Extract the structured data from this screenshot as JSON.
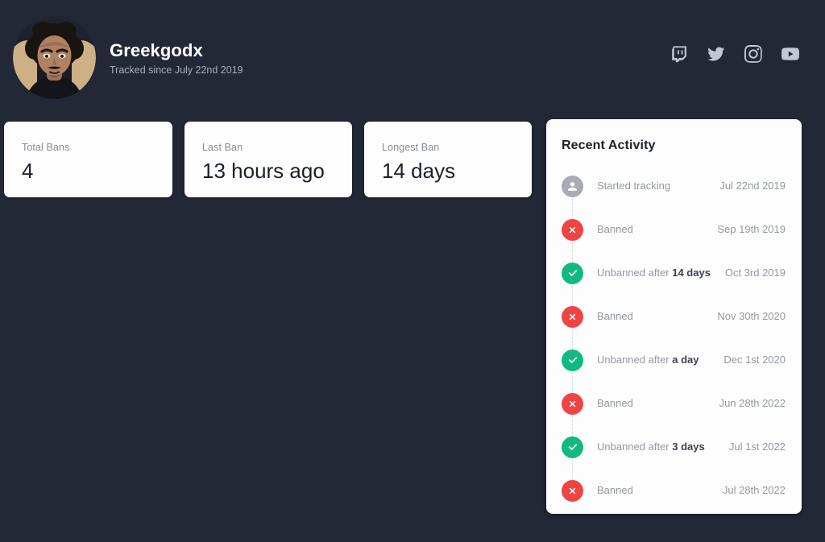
{
  "profile": {
    "display_name": "Greekgodx",
    "tracked_since": "Tracked since July 22nd 2019",
    "avatar_alt": "avatar"
  },
  "socials": [
    {
      "name": "twitch",
      "label": "Twitch"
    },
    {
      "name": "twitter",
      "label": "Twitter"
    },
    {
      "name": "instagram",
      "label": "Instagram"
    },
    {
      "name": "youtube",
      "label": "YouTube"
    }
  ],
  "stats": [
    {
      "label": "Total Bans",
      "value": "4"
    },
    {
      "label": "Last Ban",
      "value": "13 hours ago"
    },
    {
      "label": "Longest Ban",
      "value": "14 days"
    }
  ],
  "activity": {
    "title": "Recent Activity",
    "rows": [
      {
        "type": "track",
        "text": "Started tracking",
        "highlight": "",
        "date": "Jul 22nd 2019"
      },
      {
        "type": "banned",
        "text": "Banned",
        "highlight": "",
        "date": "Sep 19th 2019"
      },
      {
        "type": "unban",
        "text": "Unbanned after ",
        "highlight": "14 days",
        "date": "Oct 3rd 2019"
      },
      {
        "type": "banned",
        "text": "Banned",
        "highlight": "",
        "date": "Nov 30th 2020"
      },
      {
        "type": "unban",
        "text": "Unbanned after ",
        "highlight": "a day",
        "date": "Dec 1st 2020"
      },
      {
        "type": "banned",
        "text": "Banned",
        "highlight": "",
        "date": "Jun 28th 2022"
      },
      {
        "type": "unban",
        "text": "Unbanned after ",
        "highlight": "3 days",
        "date": "Jul 1st 2022"
      },
      {
        "type": "banned",
        "text": "Banned",
        "highlight": "",
        "date": "Jul 28th 2022"
      }
    ]
  },
  "colors": {
    "background": "#232836",
    "card": "#fdfdfd",
    "banned": "#ee4444",
    "unbanned": "#10b981",
    "neutral": "#a8abb3",
    "muted_text": "#9398a4",
    "dark_text": "#1b1f2b"
  }
}
